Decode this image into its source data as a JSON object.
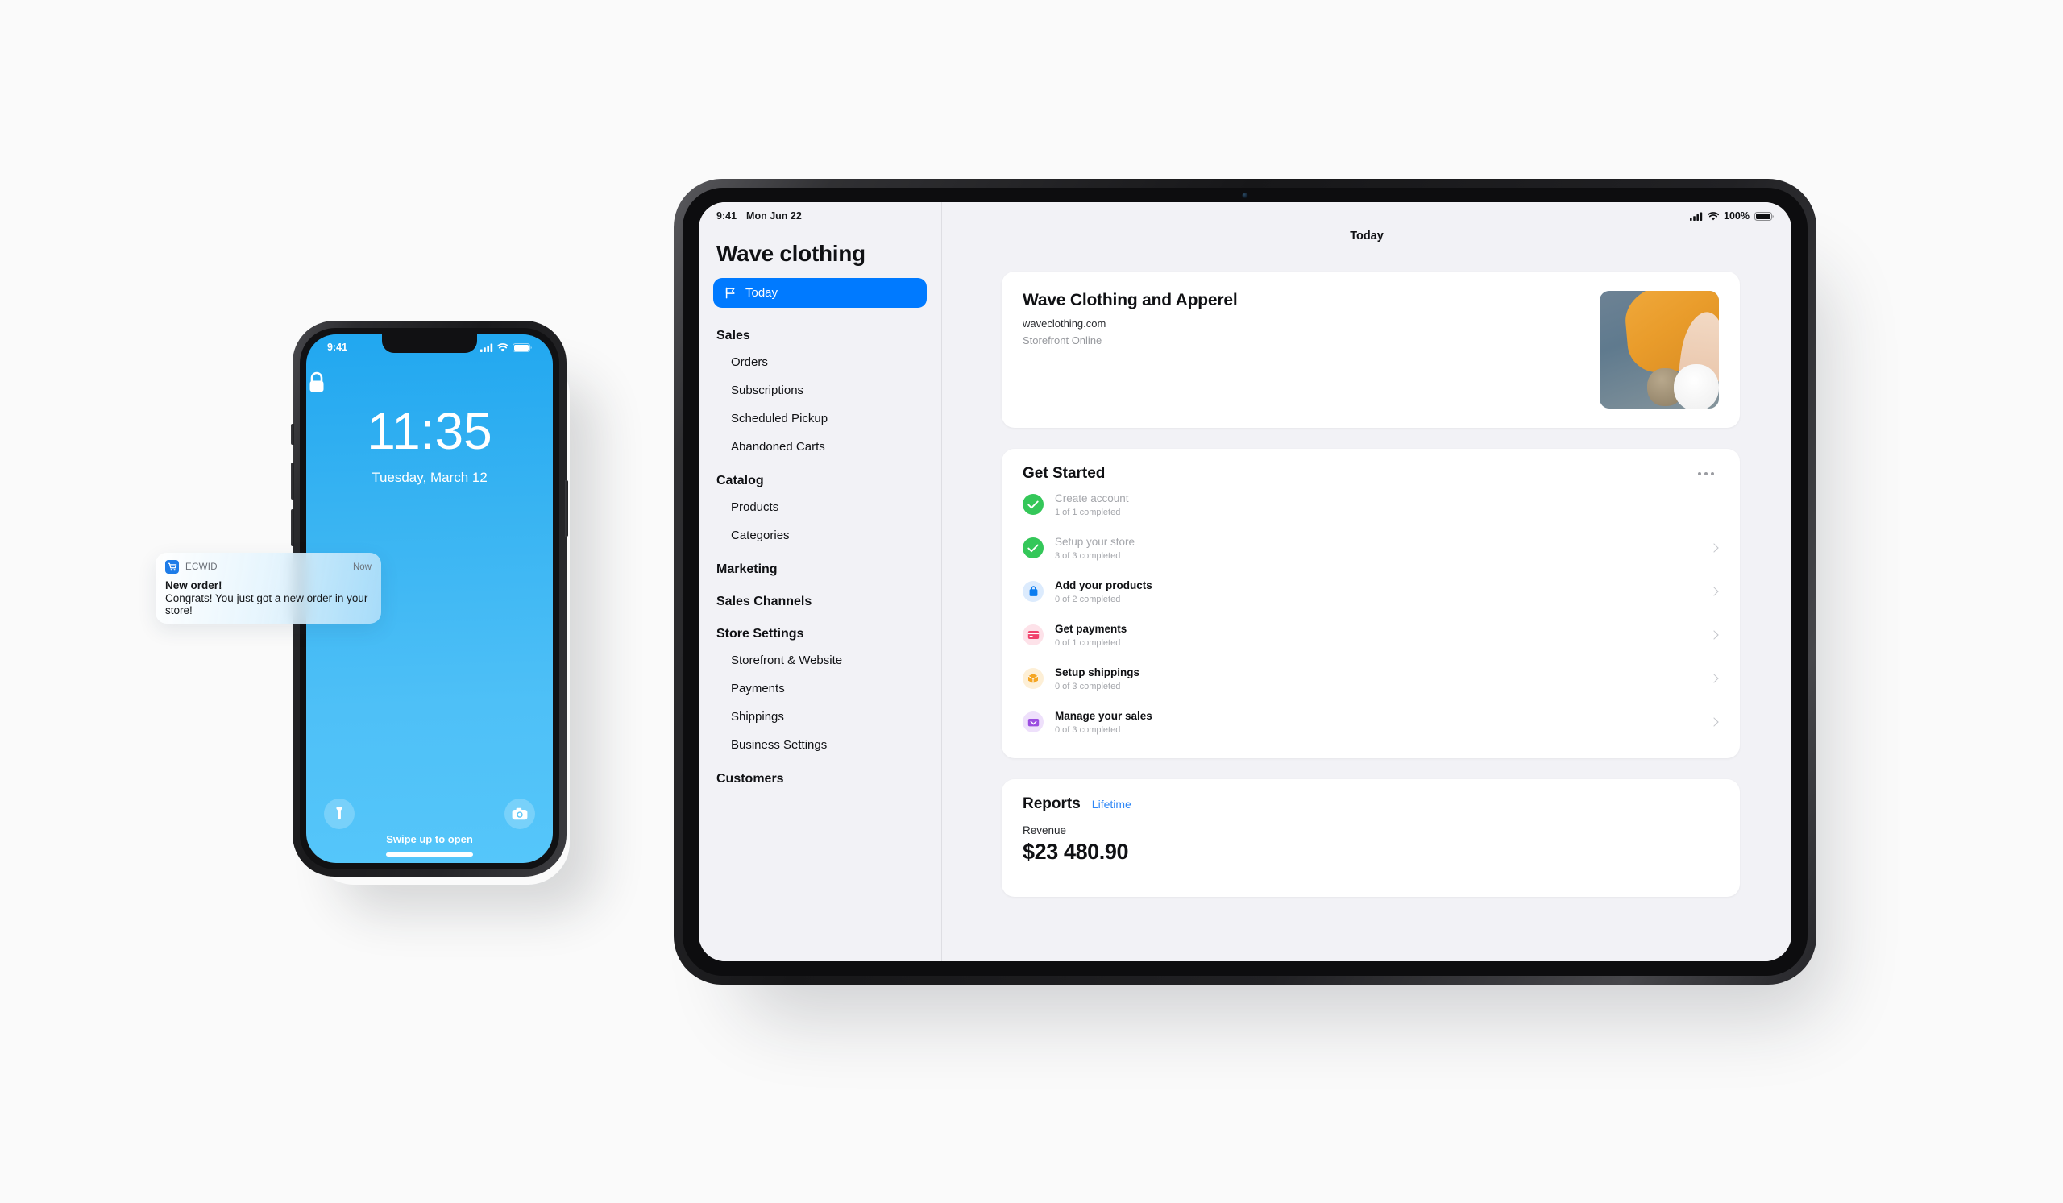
{
  "phone": {
    "status": {
      "time": "9:41",
      "icons": [
        "cellular-signal",
        "wifi",
        "battery"
      ]
    },
    "lock_icon": "lock-icon",
    "clock": "11:35",
    "date": "Tuesday, March 12",
    "flashlight_icon": "flashlight-icon",
    "camera_icon": "camera-icon",
    "swipe_hint": "Swipe up to open",
    "notification": {
      "app_icon": "shopping-cart-icon",
      "app_name": "ECWID",
      "time": "Now",
      "title": "New order!",
      "body": "Congrats! You just got a new order in your store!"
    },
    "wallpaper_color": "#3BB5F2"
  },
  "tablet": {
    "status": {
      "time": "9:41",
      "date": "Mon Jun 22",
      "battery_percent": "100%",
      "icons": [
        "cellular-signal",
        "wifi",
        "battery"
      ]
    },
    "page_title": "Today",
    "sidebar": {
      "store_name": "Wave clothing",
      "active_item": {
        "label": "Today",
        "icon": "flag-icon"
      },
      "groups": [
        {
          "heading": "Sales",
          "items": [
            "Orders",
            "Subscriptions",
            "Scheduled Pickup",
            "Abandoned Carts"
          ]
        },
        {
          "heading": "Catalog",
          "items": [
            "Products",
            "Categories"
          ]
        },
        {
          "heading": "Marketing",
          "items": []
        },
        {
          "heading": "Sales Channels",
          "items": []
        },
        {
          "heading": "Store Settings",
          "items": [
            "Storefront & Website",
            "Payments",
            "Shippings",
            "Business Settings"
          ]
        },
        {
          "heading": "Customers",
          "items": []
        }
      ]
    },
    "store_card": {
      "name": "Wave Clothing and Apperel",
      "url": "waveclothing.com",
      "status": "Storefront Online",
      "thumbnail": "store-photo"
    },
    "get_started": {
      "title": "Get Started",
      "more_icon": "ellipsis-icon",
      "items": [
        {
          "label": "Create account",
          "progress": "1 of 1 completed",
          "icon": "check-icon",
          "icon_color": "#34C759",
          "icon_bg": "#34C759",
          "state": "done",
          "chevron": false
        },
        {
          "label": "Setup your store",
          "progress": "3 of 3 completed",
          "icon": "check-icon",
          "icon_color": "#34C759",
          "icon_bg": "#34C759",
          "state": "done",
          "chevron": true
        },
        {
          "label": "Add your products",
          "progress": "0 of 2 completed",
          "icon": "bag-icon",
          "icon_color": "#0A7CF0",
          "icon_bg": "#DCEBFD",
          "state": "todo",
          "chevron": true
        },
        {
          "label": "Get payments",
          "progress": "0 of 1 completed",
          "icon": "credit-card-icon",
          "icon_color": "#F0426C",
          "icon_bg": "#FDE2E9",
          "state": "todo",
          "chevron": true
        },
        {
          "label": "Setup shippings",
          "progress": "0 of 3 completed",
          "icon": "box-icon",
          "icon_color": "#F5A623",
          "icon_bg": "#FDEFD6",
          "state": "todo",
          "chevron": true
        },
        {
          "label": "Manage your sales",
          "progress": "0 of 3 completed",
          "icon": "inbox-icon",
          "icon_color": "#9B4DE0",
          "icon_bg": "#EEE0FB",
          "state": "todo",
          "chevron": true
        }
      ]
    },
    "reports": {
      "title": "Reports",
      "period": "Lifetime",
      "metric_label": "Revenue",
      "metric_value": "$23 480.90"
    }
  },
  "colors": {
    "page_background": "#FAFAFA",
    "accent_blue": "#007AFF",
    "link_blue": "#2F87F6",
    "screen_background": "#F2F2F6"
  }
}
